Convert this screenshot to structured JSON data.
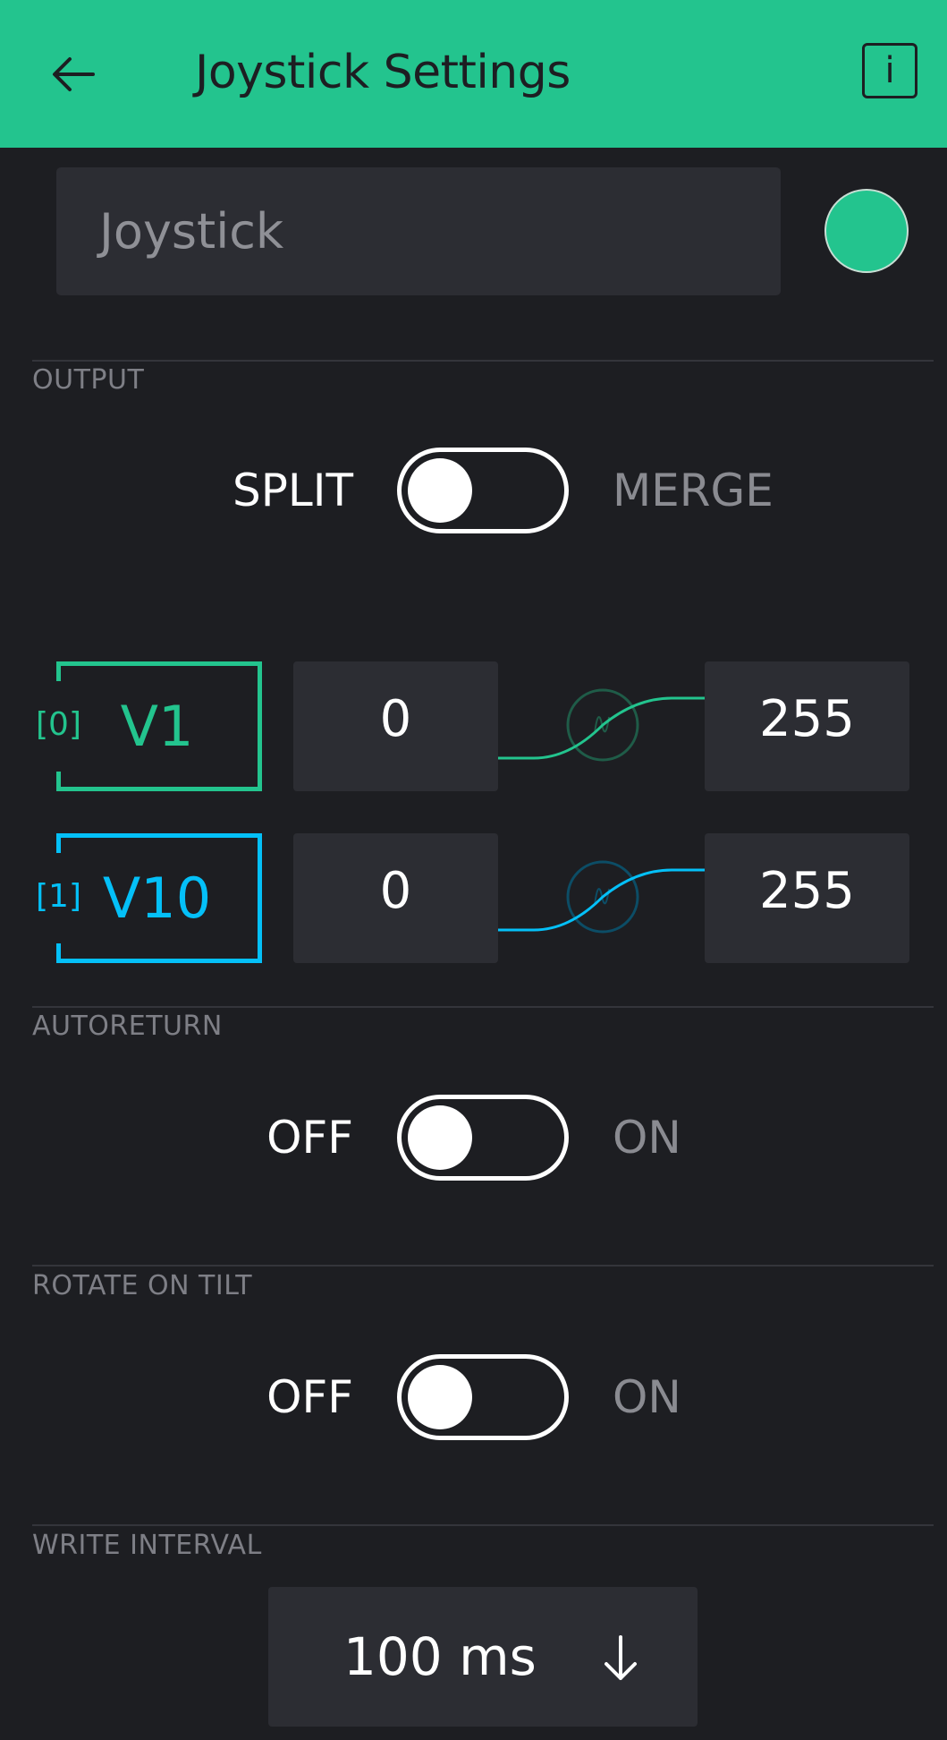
{
  "header": {
    "title": "Joystick Settings",
    "back_icon": "arrow-left-icon",
    "info_label": "i",
    "bg_color": "#23c48e"
  },
  "widget": {
    "name": "Joystick",
    "color": "#23c48e"
  },
  "output": {
    "label": "OUTPUT",
    "toggle": {
      "left": "SPLIT",
      "right": "MERGE",
      "state": "off"
    },
    "pins": [
      {
        "index": "[0]",
        "pin": "V1",
        "min": "0",
        "max": "255",
        "color": "#23c48e"
      },
      {
        "index": "[1]",
        "pin": "V10",
        "min": "0",
        "max": "255",
        "color": "#04c0f8"
      }
    ]
  },
  "autoreturn": {
    "label": "AUTORETURN",
    "toggle": {
      "left": "OFF",
      "right": "ON",
      "state": "off"
    }
  },
  "rotate": {
    "label": "ROTATE ON TILT",
    "toggle": {
      "left": "OFF",
      "right": "ON",
      "state": "off"
    }
  },
  "write_interval": {
    "label": "WRITE INTERVAL",
    "value": "100 ms",
    "icon": "arrow-down-icon"
  }
}
